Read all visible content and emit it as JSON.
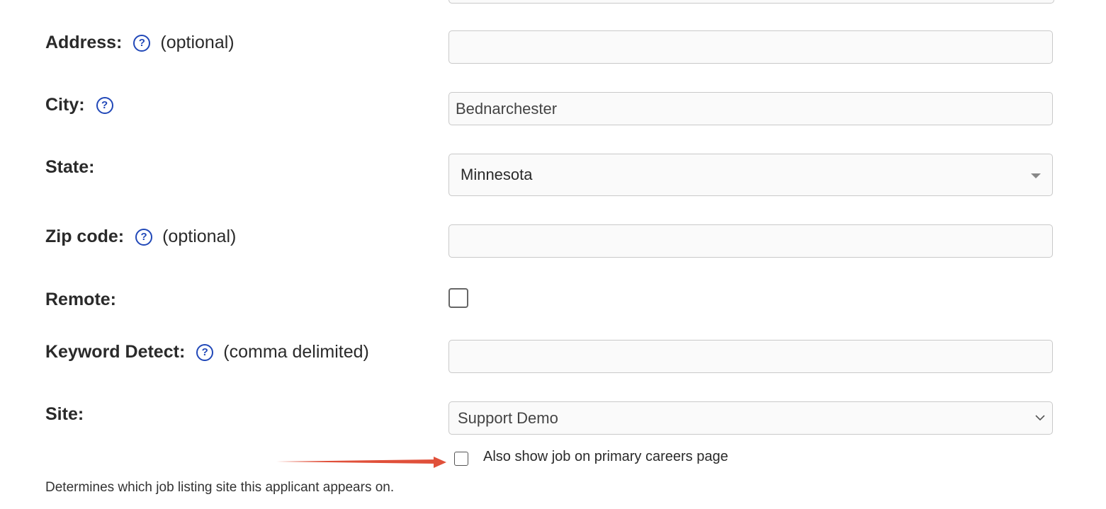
{
  "form": {
    "address": {
      "label": "Address:",
      "hint": "(optional)",
      "value": ""
    },
    "city": {
      "label": "City:",
      "value": "Bednarchester"
    },
    "state": {
      "label": "State:",
      "value": "Minnesota"
    },
    "zip": {
      "label": "Zip code:",
      "hint": "(optional)",
      "value": ""
    },
    "remote": {
      "label": "Remote:",
      "checked": false
    },
    "keyword": {
      "label": "Keyword Detect:",
      "hint": "(comma delimited)",
      "value": ""
    },
    "site": {
      "label": "Site:",
      "value": "Support Demo",
      "also_show_label": "Also show job on primary careers page",
      "help_text": "Determines which job listing site this applicant appears on."
    }
  },
  "icons": {
    "help": "?",
    "chevron_down": "⌄"
  },
  "colors": {
    "help_icon": "#2148b8",
    "arrow": "#e0503a"
  }
}
